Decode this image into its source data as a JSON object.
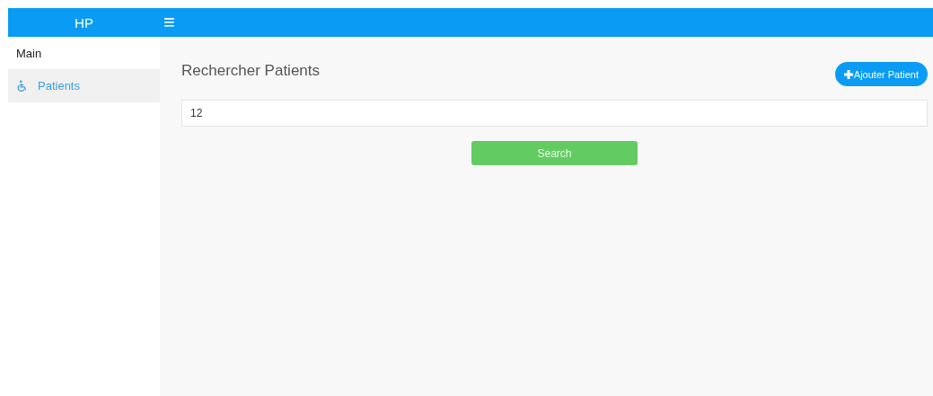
{
  "header": {
    "brand": "HP",
    "menu_icon": "≡"
  },
  "sidebar": {
    "items": [
      {
        "label": "Main",
        "kind": "heading",
        "selected": false
      },
      {
        "label": "Patients",
        "kind": "link",
        "selected": true
      }
    ]
  },
  "main": {
    "title": "Rechercher Patients",
    "add_button": "Ajouter Patient",
    "search_field": {
      "value": "12"
    },
    "search_button": "Search"
  }
}
